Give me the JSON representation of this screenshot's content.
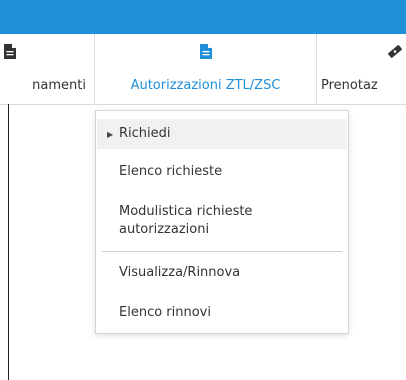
{
  "colors": {
    "topbar": "#1e8fd8",
    "accent": "#1e8fd8",
    "text": "#333333",
    "selected_bg": "#f1f1f1"
  },
  "nav": {
    "items": [
      {
        "label": "namenti",
        "icon": "document-icon"
      },
      {
        "label": "Autorizzazioni ZTL/ZSC",
        "icon": "document-icon",
        "active": true
      },
      {
        "label": "Prenotaz",
        "icon": "ticket-icon"
      }
    ]
  },
  "dropdown": {
    "items": [
      {
        "label": "Richiedi",
        "selected": true
      },
      {
        "label": "Elenco richieste"
      },
      {
        "label": "Modulistica richieste autorizzazioni"
      },
      {
        "label": "Visualizza/Rinnova"
      },
      {
        "label": "Elenco rinnovi"
      }
    ]
  }
}
